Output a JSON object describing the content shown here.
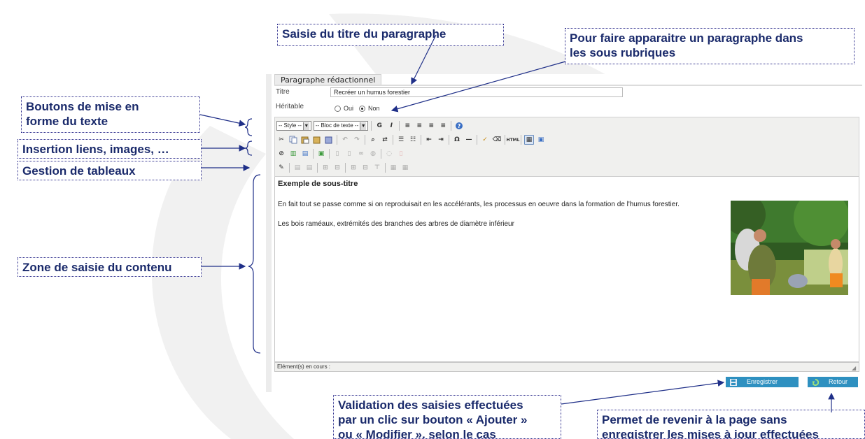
{
  "callouts": {
    "title_input": "Saisie du titre du paragraphe",
    "heritable": "Pour faire apparaitre un paragraphe dans\nles sous rubriques",
    "format_buttons": "Boutons de mise en\nforme du texte",
    "insert_links": "Insertion liens, images, …",
    "tables": "Gestion de tableaux",
    "content_zone": "Zone de saisie du contenu",
    "validation": "Validation des saisies effectuées\npar un clic sur bouton « Ajouter »\nou « Modifier », selon le cas",
    "back": "Permet de revenir à la page sans\nenregistrer les mises à jour effectuées"
  },
  "panel": {
    "tab_label": "Paragraphe rédactionnel",
    "title_label": "Titre",
    "title_value": "Recréer un humus forestier",
    "heritable_label": "Héritable",
    "radio_yes": "Oui",
    "radio_no": "Non",
    "selected": "Non"
  },
  "toolbar": {
    "style_select": "-- Style --",
    "block_select": "-- Bloc de texte --",
    "bold": "G",
    "italic": "I"
  },
  "editor": {
    "subtitle": "Exemple de sous-titre",
    "paragraph1": "En fait tout se passe comme si on reproduisait en les accélérants, les processus en oeuvre dans la formation de l'humus forestier.",
    "paragraph2": "Les bois raméaux, extrémités des branches des arbres de diamètre inférieur",
    "status": "Elément(s) en cours :"
  },
  "actions": {
    "save": "Enregistrer",
    "back": "Retour"
  },
  "colors": {
    "callout_text": "#1a2a6b",
    "arrow": "#1f2f88",
    "button_bg": "#2e90c0"
  }
}
